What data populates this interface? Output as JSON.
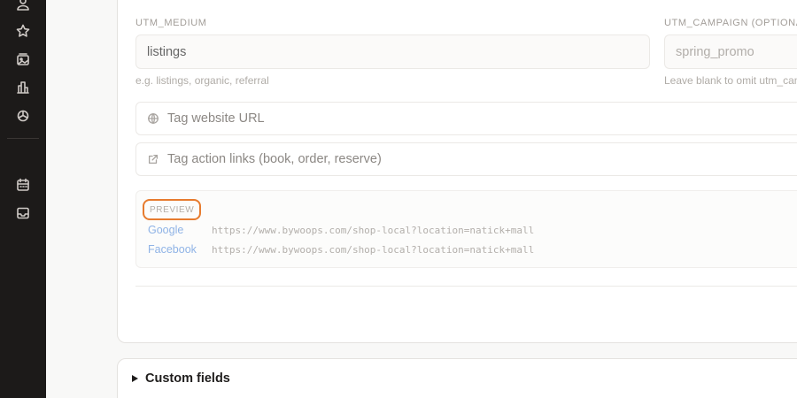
{
  "sidebar": {
    "icons": [
      "user-icon",
      "star-icon",
      "photos-icon",
      "building-icon",
      "openai-icon",
      "calendar-icon",
      "inbox-icon"
    ]
  },
  "form": {
    "utm_medium": {
      "label": "UTM_MEDIUM",
      "value": "listings",
      "hint": "e.g. listings, organic, referral"
    },
    "utm_campaign": {
      "label": "UTM_CAMPAIGN (OPTIONAL)",
      "placeholder": "spring_promo",
      "hint": "Leave blank to omit utm_campaign"
    },
    "toggles": [
      {
        "label": "Tag website URL",
        "icon": "globe-icon"
      },
      {
        "label": "Tag action links (book, order, reserve)",
        "icon": "external-link-icon"
      }
    ]
  },
  "preview": {
    "label": "PREVIEW",
    "rows": [
      {
        "name": "Google",
        "url": "https://www.bywoops.com/shop-local?location=natick+mall"
      },
      {
        "name": "Facebook",
        "url": "https://www.bywoops.com/shop-local?location=natick+mall"
      }
    ],
    "name_color": "#8fb3e6"
  },
  "custom_fields": {
    "title": "Custom fields"
  },
  "colors": {
    "highlight": "#e77b2e",
    "sidebar_bg": "#1c1a19"
  }
}
